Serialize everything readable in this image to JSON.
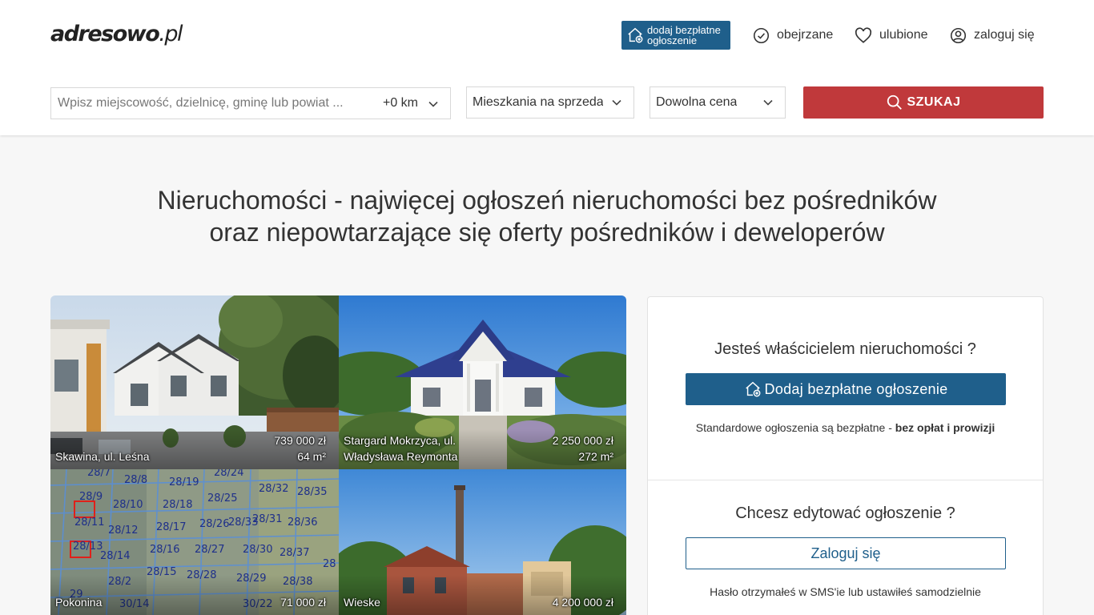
{
  "header": {
    "logo_main": "adresowo",
    "logo_tld": ".pl",
    "add_listing_label": "dodaj bezpłatne ogłoszenie",
    "nav": {
      "viewed": "obejrzane",
      "favorites": "ulubione",
      "login": "zaloguj się"
    }
  },
  "search": {
    "placeholder": "Wpisz miejscowość, dzielnicę, gminę lub powiat ...",
    "radius": "+0 km",
    "property_type": "Mieszkania na sprzedaż",
    "price": "Dowolna cena",
    "submit_label": "SZUKAJ"
  },
  "headline": {
    "line1": "Nieruchomości - najwięcej ogłoszeń nieruchomości bez pośredników",
    "line2": "oraz niepowtarzające się oferty pośredników i deweloperów"
  },
  "listings": [
    {
      "location": "Skawina, ul. Leśna",
      "price": "739 000 zł",
      "area": "64 m²"
    },
    {
      "location": "Stargard Mokrzyca, ul. Władysława Reymonta",
      "price": "2 250 000 zł",
      "area": "272 m²"
    },
    {
      "location": "Pokonina",
      "price": "71 000 zł",
      "area": ""
    },
    {
      "location": "Wieske",
      "price": "4 200 000 zł",
      "area": ""
    }
  ],
  "owner_panel": {
    "owner_title": "Jesteś właścicielem nieruchomości ?",
    "add_button": "Dodaj bezpłatne ogłoszenie",
    "free_note_prefix": "Standardowe ogłoszenia są bezpłatne - ",
    "free_note_bold": "bez opłat i prowizji",
    "edit_title": "Chcesz edytować ogłoszenie ?",
    "login_button": "Zaloguj się",
    "password_note": "Hasło otrzymałeś w SMS'ie lub ustawiłeś samodzielnie"
  },
  "colors": {
    "primary_blue": "#1f5f8b",
    "search_red": "#c0393b"
  }
}
